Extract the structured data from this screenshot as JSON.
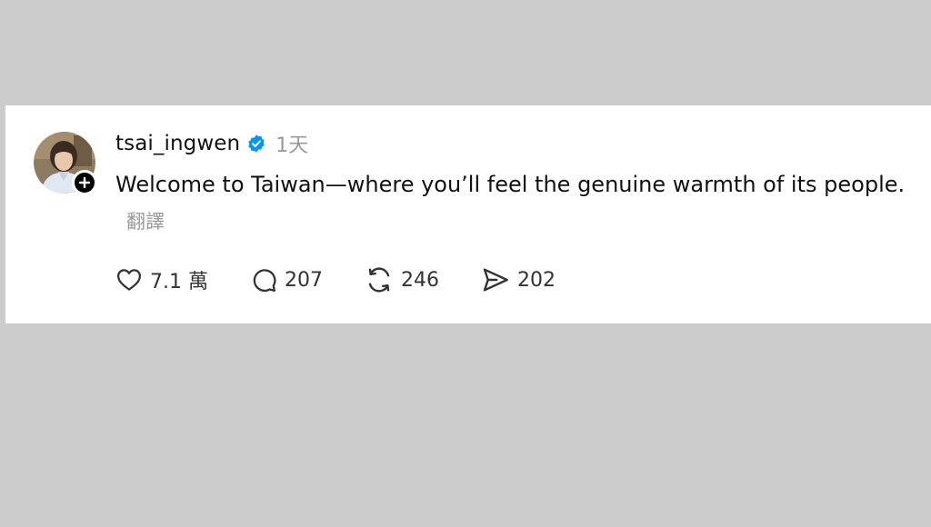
{
  "post": {
    "username": "tsai_ingwen",
    "timestamp": "1天",
    "text": "Welcome to Taiwan—where you’ll feel the genuine warmth of its people.",
    "translate_label": "翻譯",
    "likes": "7.1 萬",
    "replies": "207",
    "reposts": "246",
    "shares": "202"
  },
  "icons": {
    "verified": "verified-badge-icon",
    "follow": "plus-icon",
    "like": "heart-icon",
    "reply": "speech-bubble-icon",
    "repost": "repost-arrows-icon",
    "share": "paper-plane-icon"
  },
  "colors": {
    "background": "#cccccc",
    "card": "#ffffff",
    "text": "#111111",
    "muted": "#999999",
    "verified": "#0095f6"
  }
}
